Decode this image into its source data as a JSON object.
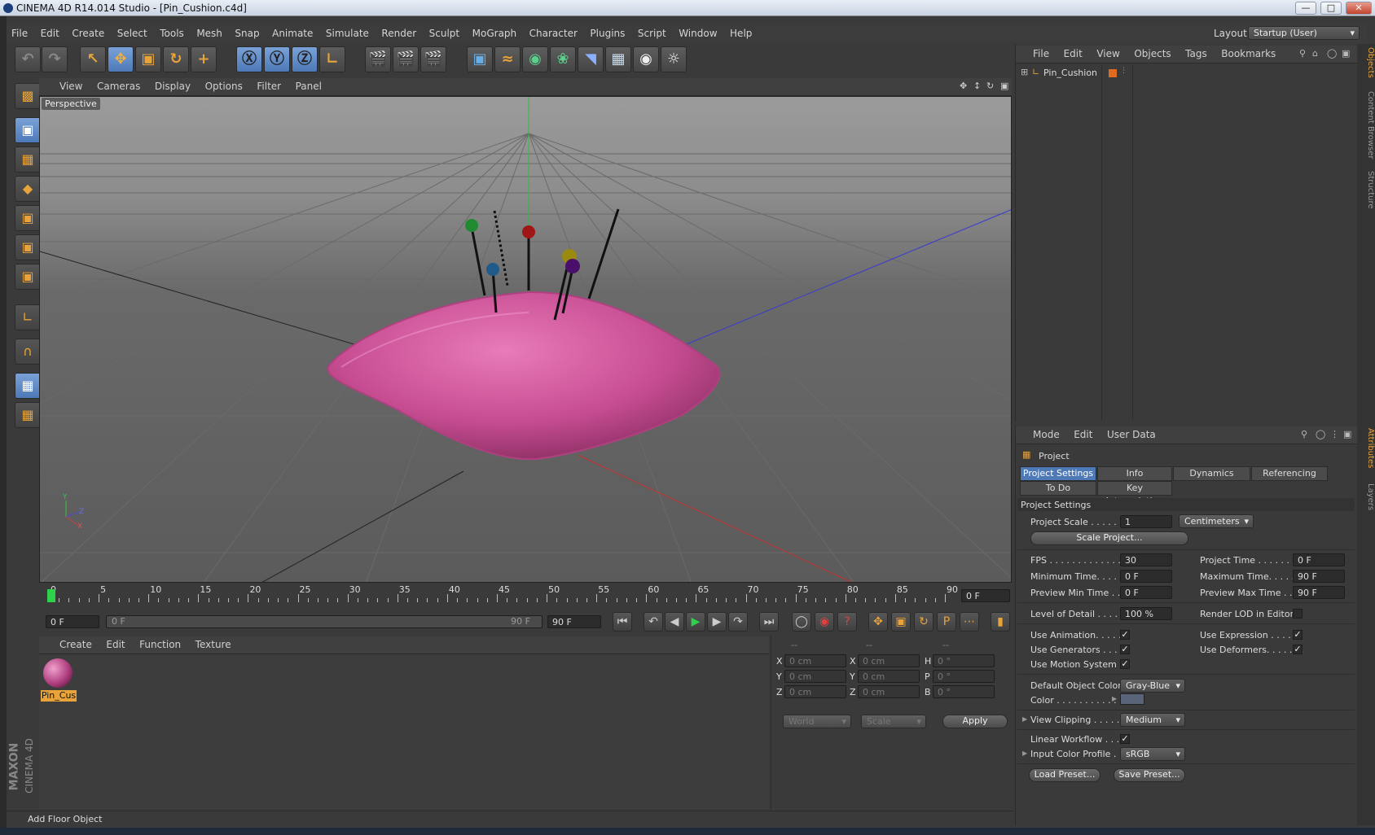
{
  "window": {
    "title": "CINEMA 4D R14.014 Studio - [Pin_Cushion.c4d]"
  },
  "menubar": {
    "items": [
      "File",
      "Edit",
      "Create",
      "Select",
      "Tools",
      "Mesh",
      "Snap",
      "Animate",
      "Simulate",
      "Render",
      "Sculpt",
      "MoGraph",
      "Character",
      "Plugins",
      "Script",
      "Window",
      "Help"
    ],
    "layout_label": "Layout:",
    "layout_value": "Startup (User)"
  },
  "viewport": {
    "menu": [
      "View",
      "Cameras",
      "Display",
      "Options",
      "Filter",
      "Panel"
    ],
    "label": "Perspective",
    "axis_x": "X",
    "axis_y": "Y",
    "axis_z": "Z"
  },
  "timeline": {
    "ticks": [
      "0",
      "5",
      "10",
      "15",
      "20",
      "25",
      "30",
      "35",
      "40",
      "45",
      "50",
      "55",
      "60",
      "65",
      "70",
      "75",
      "80",
      "85",
      "90"
    ],
    "current_frame": "0 F",
    "start": "0 F",
    "slider_start": "0 F",
    "slider_end": "90 F",
    "end": "90 F"
  },
  "material_manager": {
    "menu": [
      "Create",
      "Edit",
      "Function",
      "Texture"
    ],
    "material_name": "Pin_Cus"
  },
  "coordinates": {
    "headers": [
      "--",
      "--",
      "--"
    ],
    "rows": [
      {
        "a": "X",
        "av": "0 cm",
        "b": "X",
        "bv": "0 cm",
        "c": "H",
        "cv": "0 °"
      },
      {
        "a": "Y",
        "av": "0 cm",
        "b": "Y",
        "bv": "0 cm",
        "c": "P",
        "cv": "0 °"
      },
      {
        "a": "Z",
        "av": "0 cm",
        "b": "Z",
        "bv": "0 cm",
        "c": "B",
        "cv": "0 °"
      }
    ],
    "mode1": "World",
    "mode2": "Scale",
    "apply": "Apply"
  },
  "status": {
    "text": "Add Floor Object"
  },
  "brand": {
    "line1": "MAXON",
    "line2": "CINEMA 4D"
  },
  "object_manager": {
    "menu": [
      "File",
      "Edit",
      "View",
      "Objects",
      "Tags",
      "Bookmarks"
    ],
    "object_name": "Pin_Cushion"
  },
  "attributes": {
    "menu": [
      "Mode",
      "Edit",
      "User Data"
    ],
    "header": "Project",
    "tabs": [
      "Project Settings",
      "Info",
      "Dynamics",
      "Referencing"
    ],
    "tabs2": [
      "To Do",
      "Key Interpolation"
    ],
    "section": "Project Settings",
    "project_scale_label": "Project Scale . . . . . .",
    "project_scale_value": "1",
    "project_scale_unit": "Centimeters",
    "scale_project_btn": "Scale Project...",
    "fps_label": "FPS . . . . . . . . . . . . . .",
    "fps_value": "30",
    "project_time_label": "Project Time . . . . . . . .",
    "project_time_value": "0 F",
    "min_time_label": "Minimum Time. . . . .",
    "min_time_value": "0 F",
    "max_time_label": "Maximum Time. . . . . .",
    "max_time_value": "90 F",
    "prev_min_label": "Preview Min Time . .",
    "prev_min_value": "0 F",
    "prev_max_label": "Preview Max Time . . .",
    "prev_max_value": "90 F",
    "lod_label": "Level of Detail . . . . .",
    "lod_value": "100 %",
    "render_lod_label": "Render LOD in Editor",
    "use_animation": "Use Animation. . . . .",
    "use_expression": "Use Expression . . . . .",
    "use_generators": "Use Generators . . . .",
    "use_deformers": "Use Deformers. . . . . . .",
    "use_motion": "Use Motion System",
    "default_color_label": "Default Object Color",
    "default_color_value": "Gray-Blue",
    "color_label": "Color . . . . . . . . . . .",
    "view_clipping_label": "View Clipping . . . . .",
    "view_clipping_value": "Medium",
    "linear_workflow_label": "Linear Workflow . . .",
    "input_color_label": "Input Color Profile . .",
    "input_color_value": "sRGB",
    "load_preset": "Load Preset...",
    "save_preset": "Save Preset..."
  },
  "side_tabs": {
    "objects": "Objects",
    "content": "Content Browser",
    "structure": "Structure",
    "attributes": "Attributes",
    "layers": "Layers"
  },
  "colors": {
    "accent": "#4d79b7",
    "cushion": "#d65aa0",
    "highlight": "#e8a33a"
  }
}
